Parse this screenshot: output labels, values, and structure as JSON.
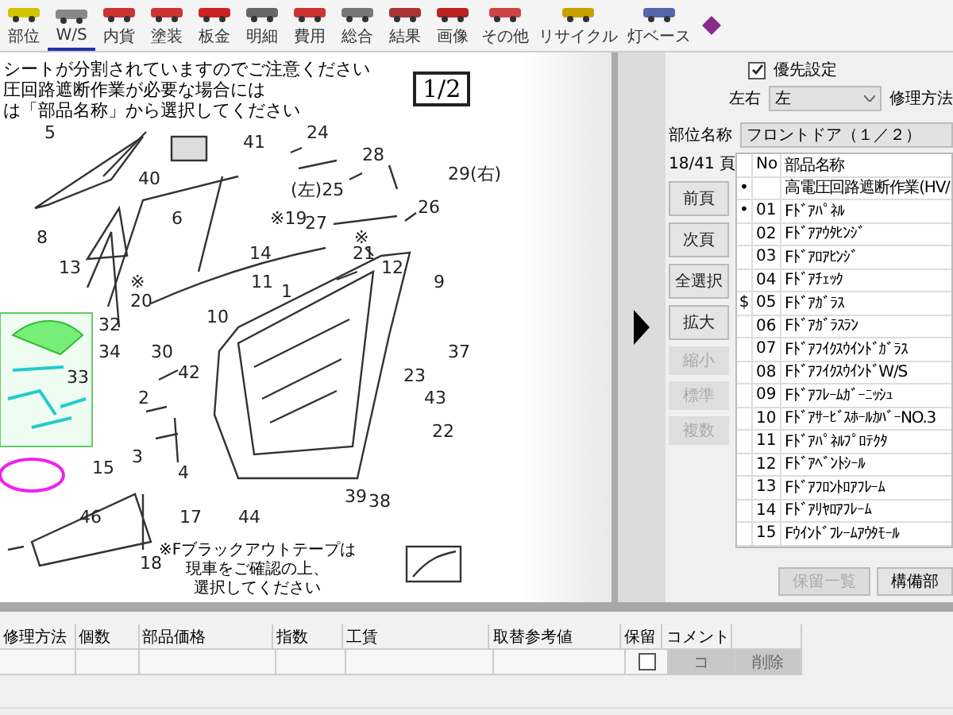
{
  "toolbar": [
    {
      "label": "部位",
      "selected": false
    },
    {
      "label": "W/S",
      "selected": true
    },
    {
      "label": "内貨",
      "selected": false
    },
    {
      "label": "塗装",
      "selected": false
    },
    {
      "label": "板金",
      "selected": false
    },
    {
      "label": "明細",
      "selected": false
    },
    {
      "label": "費用",
      "selected": false
    },
    {
      "label": "総合",
      "selected": false
    },
    {
      "label": "結果",
      "selected": false
    },
    {
      "label": "画像",
      "selected": false
    },
    {
      "label": "その他",
      "selected": false
    },
    {
      "label": "リサイクル",
      "selected": false
    },
    {
      "label": "灯ベース",
      "selected": false
    }
  ],
  "diagram": {
    "notes": [
      "シートが分割されていますのでご注意ください",
      "圧回路遮断作業が必要な場合には",
      "は「部品名称」から選択してください"
    ],
    "page": "1/2",
    "footnote": [
      "※Fブラックアウトテープは",
      "現車をご確認の上、",
      "選択してください"
    ],
    "callouts": [
      {
        "label": "5"
      },
      {
        "label": "24"
      },
      {
        "label": "41"
      },
      {
        "label": "28"
      },
      {
        "label": "29(右)"
      },
      {
        "label": "40"
      },
      {
        "label": "(左)25"
      },
      {
        "label": "26"
      },
      {
        "label": "6"
      },
      {
        "label": "※19"
      },
      {
        "label": "27"
      },
      {
        "label": "8"
      },
      {
        "label": "※"
      },
      {
        "label": "14"
      },
      {
        "label": "21"
      },
      {
        "label": "13"
      },
      {
        "label": "12"
      },
      {
        "label": "※"
      },
      {
        "label": "11"
      },
      {
        "label": "9"
      },
      {
        "label": "1"
      },
      {
        "label": "20"
      },
      {
        "label": "10"
      },
      {
        "label": "32"
      },
      {
        "label": "34"
      },
      {
        "label": "30"
      },
      {
        "label": "37"
      },
      {
        "label": "33"
      },
      {
        "label": "42"
      },
      {
        "label": "23"
      },
      {
        "label": "2"
      },
      {
        "label": "43"
      },
      {
        "label": "22"
      },
      {
        "label": "3"
      },
      {
        "label": "15"
      },
      {
        "label": "4"
      },
      {
        "label": "39"
      },
      {
        "label": "38"
      },
      {
        "label": "46"
      },
      {
        "label": "17"
      },
      {
        "label": "44"
      },
      {
        "label": "18"
      }
    ]
  },
  "panel": {
    "priority": {
      "label": "優先設定",
      "checked": true
    },
    "side_label": "左右",
    "side_value": "左",
    "repair_label": "修理方法",
    "part_label": "部位名称",
    "part_value": "フロントドア（１／２）",
    "page": "18/41 頁",
    "buttons": [
      {
        "label": "前頁",
        "disabled": false
      },
      {
        "label": "次頁",
        "disabled": false
      },
      {
        "label": "全選択",
        "disabled": false
      },
      {
        "label": "拡大",
        "disabled": false
      },
      {
        "label": "縮小",
        "disabled": true
      },
      {
        "label": "標準",
        "disabled": true
      },
      {
        "label": "複数",
        "disabled": true
      }
    ],
    "columns": [
      "No",
      "部品名称"
    ],
    "rows": [
      {
        "mark": "•",
        "no": "",
        "name": "高電圧回路遮断作業(HV/"
      },
      {
        "mark": "•",
        "no": "01",
        "name": "Fﾄﾞｱﾊﾟﾈﾙ"
      },
      {
        "mark": "",
        "no": "02",
        "name": "Fﾄﾞｱｱｳﾀﾋﾝｼﾞ"
      },
      {
        "mark": "",
        "no": "03",
        "name": "Fﾄﾞｱﾛｱﾋﾝｼﾞ"
      },
      {
        "mark": "",
        "no": "04",
        "name": "Fﾄﾞｱﾁｪｯｸ"
      },
      {
        "mark": "$",
        "no": "05",
        "name": "Fﾄﾞｱｶﾞﾗｽ"
      },
      {
        "mark": "",
        "no": "06",
        "name": "Fﾄﾞｱｶﾞﾗｽﾗﾝ"
      },
      {
        "mark": "",
        "no": "07",
        "name": "Fﾄﾞｱﾌｲｸｽｳｲﾝﾄﾞｶﾞﾗｽ"
      },
      {
        "mark": "",
        "no": "08",
        "name": "FﾄﾞｱﾌｲｸｽｳｲﾝﾄﾞW/S"
      },
      {
        "mark": "",
        "no": "09",
        "name": "Fﾄﾞｱﾌﾚｰﾑｶﾞｰﾆｯｼｭ"
      },
      {
        "mark": "",
        "no": "10",
        "name": "FﾄﾞｱｻｰﾋﾞｽﾎｰﾙｶﾊﾞｰNO.3"
      },
      {
        "mark": "",
        "no": "11",
        "name": "Fﾄﾞｱﾊﾟﾈﾙﾌﾟﾛﾃｸﾀ"
      },
      {
        "mark": "",
        "no": "12",
        "name": "Fﾄﾞｱﾍﾞﾝﾄｼｰﾙ"
      },
      {
        "mark": "",
        "no": "13",
        "name": "Fﾄﾞｱﾌﾛﾝﾄﾛｱﾌﾚｰﾑ"
      },
      {
        "mark": "",
        "no": "14",
        "name": "Fﾄﾞｱﾘﾔﾛｱﾌﾚｰﾑ"
      },
      {
        "mark": "",
        "no": "15",
        "name": "Fｳｲﾝﾄﾞﾌﾚｰﾑｱｳﾀﾓｰﾙ"
      }
    ],
    "bottom_buttons": [
      {
        "label": "保留一覧",
        "disabled": true
      },
      {
        "label": "構備部",
        "disabled": false
      }
    ]
  },
  "detail_table": {
    "columns": [
      "修理方法",
      "個数",
      "部品価格",
      "指数",
      "工賃",
      "取替参考値",
      "保留",
      "コメント",
      ""
    ],
    "row": {
      "hold": false,
      "comment_button": "コ",
      "delete_button": "削除"
    }
  }
}
